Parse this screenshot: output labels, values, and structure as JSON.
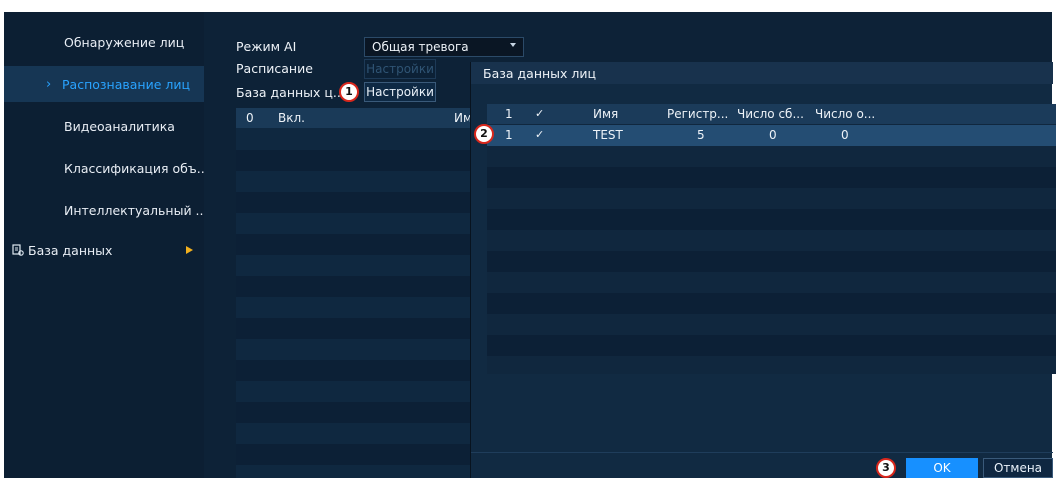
{
  "sidebar": {
    "items": [
      {
        "label": "Обнаружение лиц"
      },
      {
        "label": "Распознавание лиц"
      },
      {
        "label": "Видеоаналитика"
      },
      {
        "label": "Классификация объ..."
      },
      {
        "label": "Интеллектуальный ..."
      },
      {
        "label": "База данных"
      }
    ],
    "active_chevron": "›"
  },
  "main": {
    "ai_mode_label": "Режим AI",
    "ai_mode_value": "Общая тревога",
    "schedule_label": "Расписание",
    "schedule_button": "Настройки",
    "face_db_label": "База данных ц...",
    "face_db_button": "Настройки",
    "left_table": {
      "col_index": "0",
      "col_enabled": "Вкл.",
      "col_name": "Имя"
    }
  },
  "dialog": {
    "title": "База данных лиц",
    "columns": [
      "1",
      "✓",
      "Имя",
      "Регистр...",
      "Число сб...",
      "Число о..."
    ],
    "rows": [
      {
        "index": "1",
        "check": "✓",
        "name": "TEST",
        "registered": "5",
        "count_a": "0",
        "count_b": "0"
      }
    ],
    "ok_label": "OK",
    "cancel_label": "Отмена"
  },
  "callouts": {
    "one": "1",
    "two": "2",
    "three": "3"
  },
  "colors": {
    "accent": "#1790ff",
    "active_text": "#29a3ff",
    "arrow": "#f2b01e",
    "callout_border": "#d8271c"
  }
}
